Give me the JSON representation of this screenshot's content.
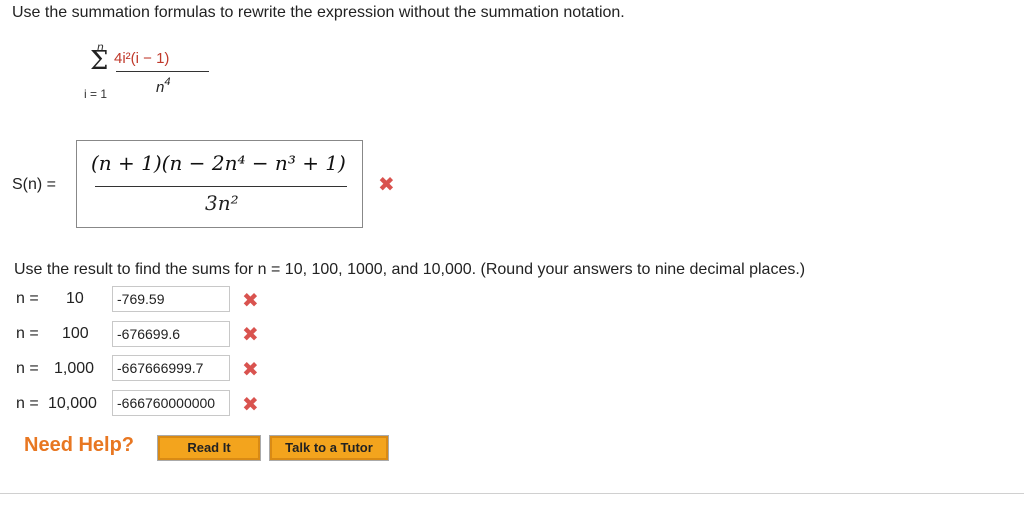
{
  "instructions": {
    "main": "Use the summation formulas to rewrite the expression without the summation notation.",
    "result": "Use the result to find the sums for n = 10, 100, 1000, and 10,000. (Round your answers to nine decimal places.)"
  },
  "summation": {
    "upper": "n",
    "symbol": "Σ",
    "lower": "i = 1",
    "numerator": "4i²(i − 1)",
    "denominator_base": "n",
    "denominator_exp": "4"
  },
  "sn": {
    "label": "S(n)  =",
    "answer_numerator": "(n + 1)(n − 2n⁴ − n³ + 1)",
    "answer_denominator": "3n²",
    "status": "incorrect"
  },
  "rows": [
    {
      "label": "n =",
      "n": "10",
      "value": "-769.59",
      "status": "incorrect"
    },
    {
      "label": "n =",
      "n": "100",
      "value": "-676699.6",
      "status": "incorrect"
    },
    {
      "label": "n =",
      "n": "1,000",
      "value": "-667666999.7",
      "status": "incorrect"
    },
    {
      "label": "n =",
      "n": "10,000",
      "value": "-666760000000",
      "status": "incorrect"
    }
  ],
  "help": {
    "label": "Need Help?",
    "read_it": "Read It",
    "talk_to_tutor": "Talk to a Tutor"
  },
  "colors": {
    "incorrect": "#d9534f",
    "highlight_red": "#c0392b",
    "help_orange": "#e87722",
    "button_fill": "#f3a41d"
  }
}
